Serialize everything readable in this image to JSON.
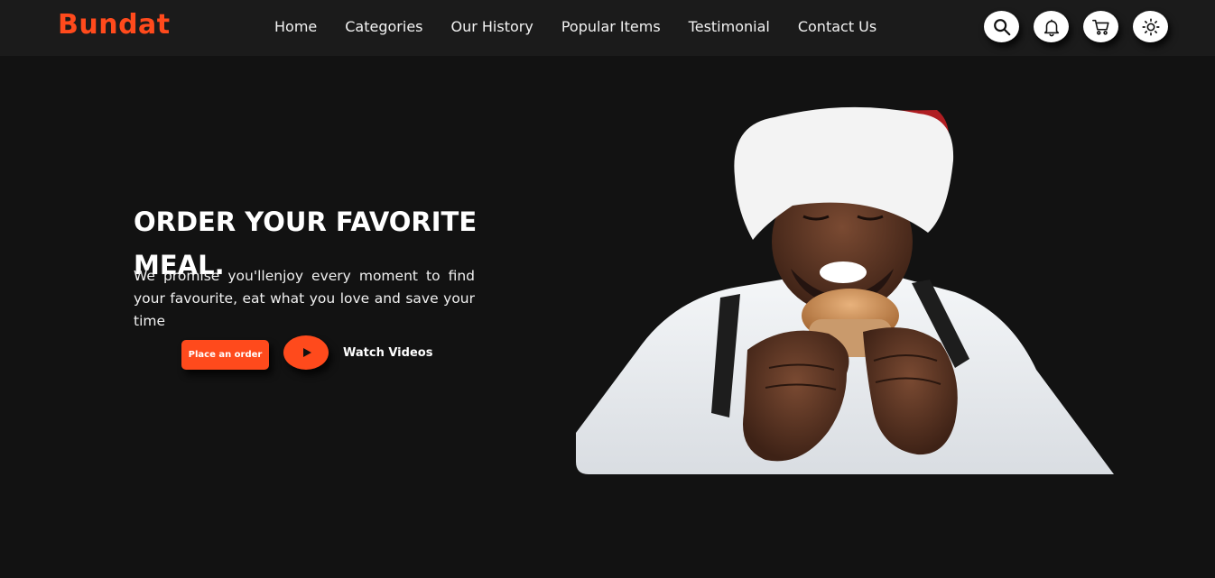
{
  "brand": {
    "name": "Bundat",
    "accent_color": "#ff4a1c"
  },
  "nav": {
    "links": [
      "Home",
      "Categories",
      "Our History",
      "Popular Items",
      "Testimonial",
      "Contact Us"
    ],
    "icons": [
      "search-icon",
      "bell-icon",
      "cart-icon",
      "sun-icon"
    ]
  },
  "hero": {
    "headline": "ORDER YOUR FAVORITE MEAL.",
    "description": "We promise you'llenjoy every moment to find your favourite, eat what you love and save your time",
    "order_button": "Place an order",
    "play_icon": "play-icon",
    "watch_label": "Watch Videos",
    "image_subject": "man-in-santa-hat-eating-burger"
  },
  "colors": {
    "background": "#121212",
    "navbar": "#1b1b1b"
  }
}
